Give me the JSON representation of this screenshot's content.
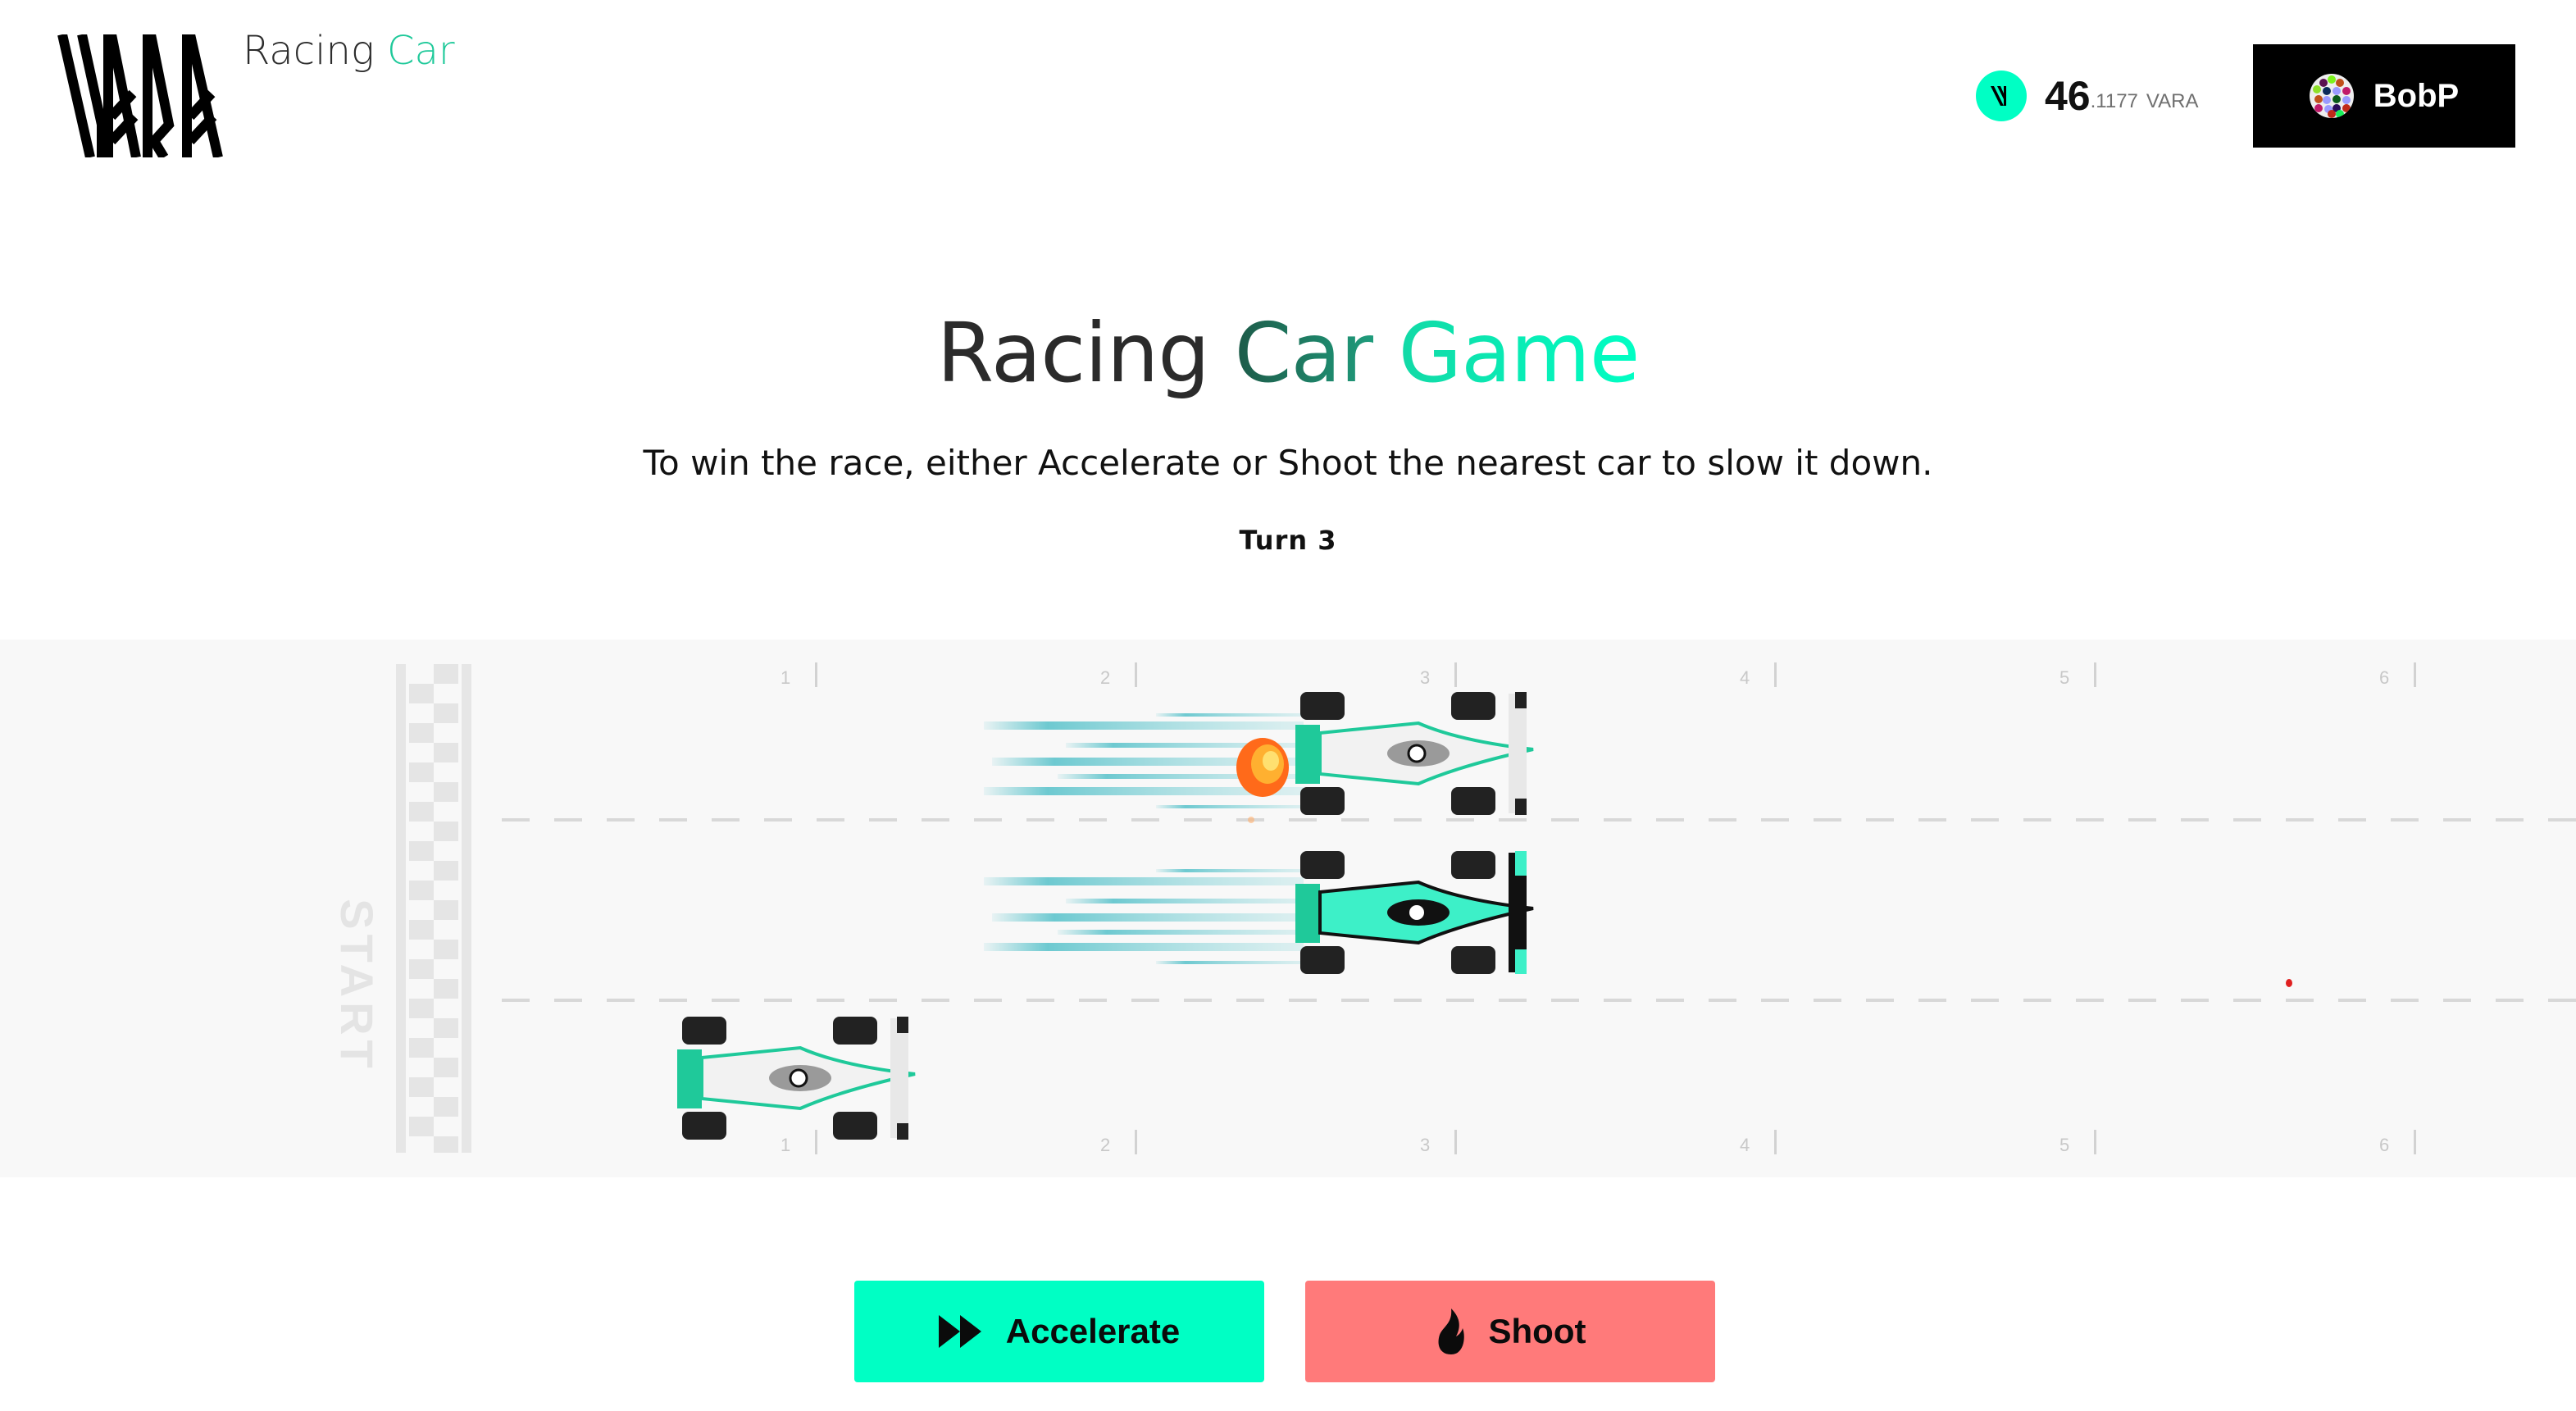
{
  "header": {
    "logo_alt": "VARA",
    "app_name_part1": "Racing",
    "app_name_part2": "Car",
    "balance": {
      "icon": "vara-coin-icon",
      "integer": "46",
      "fraction": ".1177",
      "unit": "VARA"
    },
    "account": {
      "icon": "identicon-avatar",
      "name": "BobP"
    }
  },
  "game": {
    "title_part1": "Racing",
    "title_part2": "Car",
    "title_part3": "Game",
    "instructions": "To win the race, either Accelerate or Shoot the nearest car to slow it down.",
    "turn_label": "Turn 3"
  },
  "track": {
    "start_label": "START",
    "distance_markers": [
      "1",
      "2",
      "3",
      "4",
      "5",
      "6"
    ],
    "lanes": [
      {
        "lane": 1,
        "car": "white-teal",
        "position_markers": 3.2,
        "effects": [
          "speed-lines",
          "fire-hit"
        ]
      },
      {
        "lane": 2,
        "car": "teal-black",
        "position_markers": 3.2,
        "effects": [
          "speed-lines"
        ]
      },
      {
        "lane": 3,
        "car": "white-teal",
        "position_markers": 1.3,
        "effects": []
      }
    ]
  },
  "actions": {
    "accelerate": {
      "icon": "fast-forward-icon",
      "label": "Accelerate"
    },
    "shoot": {
      "icon": "fire-icon",
      "label": "Shoot"
    }
  },
  "colors": {
    "accent": "#00ffc4",
    "shoot": "#ff7a7a",
    "dark": "#000000",
    "track_bg": "#f8f8f8"
  }
}
